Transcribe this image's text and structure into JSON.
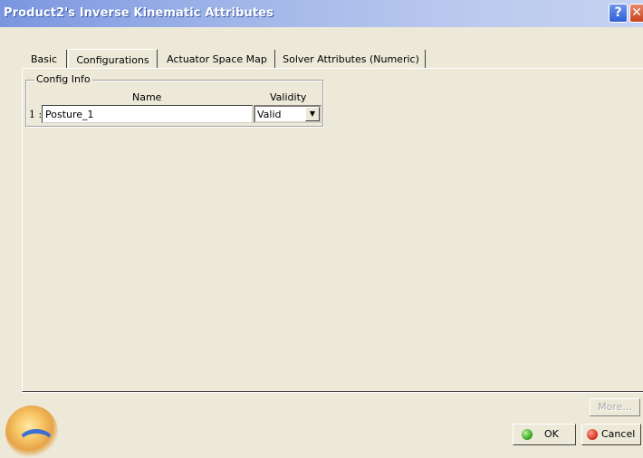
{
  "window": {
    "title": "Product2's Inverse Kinematic Attributes",
    "help_glyph": "?",
    "close_glyph": "✕"
  },
  "tabs": [
    {
      "label": "Basic",
      "active": false
    },
    {
      "label": "Configurations",
      "active": true
    },
    {
      "label": "Actuator Space Map",
      "active": false
    },
    {
      "label": "Solver Attributes (Numeric)",
      "active": false
    }
  ],
  "config_info": {
    "group_label": "Config Info",
    "col_name": "Name",
    "col_validity": "Validity",
    "rows": [
      {
        "index": "1 :",
        "name": "Posture_1",
        "validity": "Valid"
      }
    ]
  },
  "buttons": {
    "more": "More...",
    "ok": "OK",
    "cancel": "Cancel"
  },
  "colors": {
    "accent": "#7a96df",
    "ok_icon": "#2f9b1b",
    "cancel_icon": "#d32b1b"
  }
}
